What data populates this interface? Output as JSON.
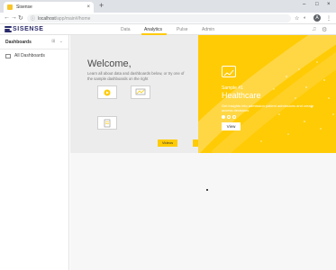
{
  "browser": {
    "tab_title": "Sisense",
    "tab_close": "×",
    "new_tab": "+",
    "win_min": "–",
    "win_max": "□",
    "win_close": "×",
    "back": "←",
    "forward": "→",
    "reload": "↻",
    "lock": "ⓘ",
    "url_host": "localhost",
    "url_path": "/app/main#/home",
    "star": "☆",
    "menu": "⋮",
    "profile": "A"
  },
  "app": {
    "logo_text": "SISENSE",
    "tabs": [
      {
        "label": "Data"
      },
      {
        "label": "Analytics"
      },
      {
        "label": "Pulse"
      },
      {
        "label": "Admin"
      }
    ],
    "active_tab": "Analytics"
  },
  "sidebar": {
    "title": "Dashboards",
    "items": [
      {
        "label": "All Dashboards"
      }
    ]
  },
  "welcome": {
    "title": "Welcome,",
    "description": "Learn all about data and dashboards below, or try one of the sample dashboards on the right",
    "cards": [
      {
        "label": "Videos"
      },
      {
        "label": "Tutorials"
      },
      {
        "label": "Documentation"
      }
    ]
  },
  "sample": {
    "kicker": "Sample #1",
    "title": "Healthcare",
    "description": "Get insights into admission patient admissions and create access decisions",
    "view_label": "View",
    "dot_count": 3,
    "active_dot": 1
  },
  "colors": {
    "accent": "#ffcb05",
    "brand": "#2a2a6a"
  }
}
